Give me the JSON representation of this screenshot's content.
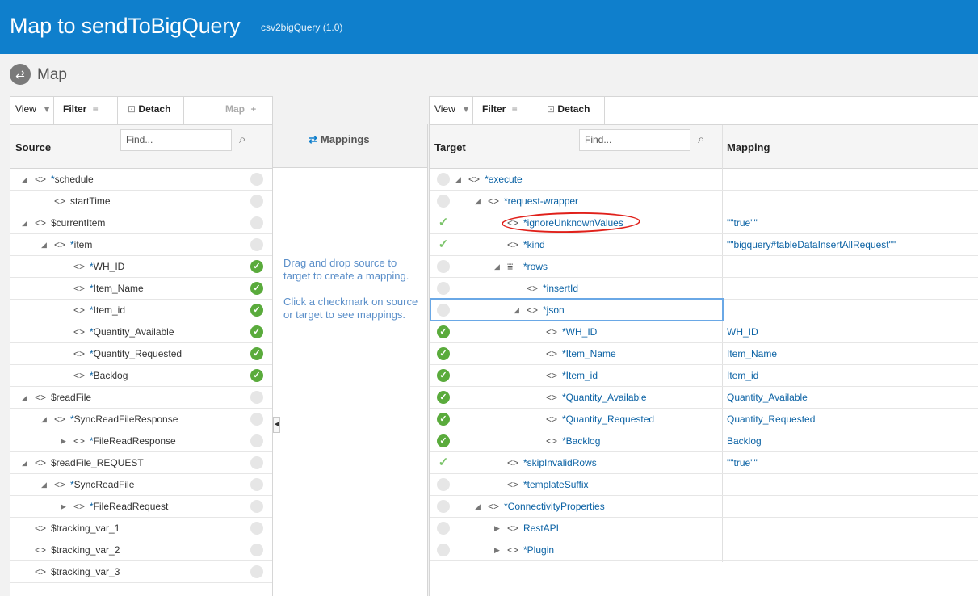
{
  "header": {
    "title": "Map to sendToBigQuery",
    "version": "csv2bigQuery (1.0)"
  },
  "subheader": {
    "label": "Map"
  },
  "toolbar": {
    "view": "View",
    "filter": "Filter",
    "detach": "Detach",
    "map": "Map",
    "view_caret": "▼",
    "filter_icon": "≡",
    "detach_icon": "⊡",
    "map_icon": "+"
  },
  "source": {
    "column_label": "Source",
    "find_placeholder": "Find...",
    "rows": [
      {
        "toggle": "◢",
        "name": "schedule",
        "required": true,
        "status": "none"
      },
      {
        "toggle": "",
        "name": "startTime",
        "required": false,
        "status": "none"
      },
      {
        "toggle": "◢",
        "name": "$currentItem",
        "required": false,
        "status": "none"
      },
      {
        "toggle": "◢",
        "name": "item",
        "required": true,
        "status": "none"
      },
      {
        "toggle": "",
        "name": "WH_ID",
        "required": true,
        "status": "mapped"
      },
      {
        "toggle": "",
        "name": "Item_Name",
        "required": true,
        "status": "mapped"
      },
      {
        "toggle": "",
        "name": "Item_id",
        "required": true,
        "status": "mapped"
      },
      {
        "toggle": "",
        "name": "Quantity_Available",
        "required": true,
        "status": "mapped"
      },
      {
        "toggle": "",
        "name": "Quantity_Requested",
        "required": true,
        "status": "mapped"
      },
      {
        "toggle": "",
        "name": "Backlog",
        "required": true,
        "status": "mapped"
      },
      {
        "toggle": "◢",
        "name": "$readFile",
        "required": false,
        "status": "none"
      },
      {
        "toggle": "◢",
        "name": "SyncReadFileResponse",
        "required": true,
        "status": "none"
      },
      {
        "toggle": "▶",
        "name": "FileReadResponse",
        "required": true,
        "status": "none"
      },
      {
        "toggle": "◢",
        "name": "$readFile_REQUEST",
        "required": false,
        "status": "none"
      },
      {
        "toggle": "◢",
        "name": "SyncReadFile",
        "required": true,
        "status": "none"
      },
      {
        "toggle": "▶",
        "name": "FileReadRequest",
        "required": true,
        "status": "none"
      },
      {
        "toggle": "",
        "name": "$tracking_var_1",
        "required": false,
        "status": "none"
      },
      {
        "toggle": "",
        "name": "$tracking_var_2",
        "required": false,
        "status": "none"
      },
      {
        "toggle": "",
        "name": "$tracking_var_3",
        "required": false,
        "status": "none"
      }
    ]
  },
  "mappings": {
    "title": "Mappings",
    "hint1": "Drag and drop source to target to create a mapping.",
    "hint2": "Click a checkmark on source or target to see mappings."
  },
  "target": {
    "column_label": "Target",
    "mapping_label": "Mapping",
    "find_placeholder": "Find...",
    "rows": [
      {
        "toggle": "◢",
        "name": "execute",
        "required": true,
        "status": "none",
        "mapping": ""
      },
      {
        "toggle": "◢",
        "name": "request-wrapper",
        "required": true,
        "status": "none",
        "mapping": ""
      },
      {
        "toggle": "",
        "name": "ignoreUnknownValues",
        "required": true,
        "status": "light",
        "mapping": "\"\"true\"\""
      },
      {
        "toggle": "",
        "name": "kind",
        "required": true,
        "status": "light",
        "mapping": "\"\"bigquery#tableDataInsertAllRequest\"\""
      },
      {
        "toggle": "◢",
        "name": "rows",
        "required": true,
        "status": "none",
        "mapping": ""
      },
      {
        "toggle": "",
        "name": "insertId",
        "required": true,
        "status": "none",
        "mapping": ""
      },
      {
        "toggle": "◢",
        "name": "json",
        "required": true,
        "status": "none",
        "mapping": ""
      },
      {
        "toggle": "",
        "name": "WH_ID",
        "required": true,
        "status": "mapped",
        "mapping": "WH_ID"
      },
      {
        "toggle": "",
        "name": "Item_Name",
        "required": true,
        "status": "mapped",
        "mapping": "Item_Name"
      },
      {
        "toggle": "",
        "name": "Item_id",
        "required": true,
        "status": "mapped",
        "mapping": "Item_id"
      },
      {
        "toggle": "",
        "name": "Quantity_Available",
        "required": true,
        "status": "mapped",
        "mapping": "Quantity_Available"
      },
      {
        "toggle": "",
        "name": "Quantity_Requested",
        "required": true,
        "status": "mapped",
        "mapping": "Quantity_Requested"
      },
      {
        "toggle": "",
        "name": "Backlog",
        "required": true,
        "status": "mapped",
        "mapping": "Backlog"
      },
      {
        "toggle": "",
        "name": "skipInvalidRows",
        "required": true,
        "status": "light",
        "mapping": "\"\"true\"\""
      },
      {
        "toggle": "",
        "name": "templateSuffix",
        "required": true,
        "status": "none",
        "mapping": ""
      },
      {
        "toggle": "◢",
        "name": "ConnectivityProperties",
        "required": true,
        "status": "none",
        "mapping": ""
      },
      {
        "toggle": "▶",
        "name": "RestAPI",
        "required": false,
        "status": "none",
        "mapping": ""
      },
      {
        "toggle": "▶",
        "name": "Plugin",
        "required": true,
        "status": "none",
        "mapping": ""
      }
    ]
  },
  "colors": {
    "header_bg": "#0f7fcc",
    "mapped_green": "#5aab3c",
    "link_blue": "#0b62a4",
    "annotation_red": "#e0201a"
  }
}
